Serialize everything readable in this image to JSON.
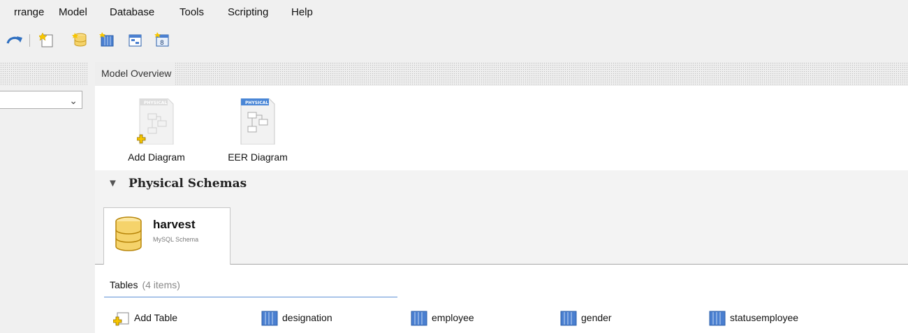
{
  "menubar": {
    "items": [
      "rrange",
      "Model",
      "Database",
      "Tools",
      "Scripting",
      "Help"
    ]
  },
  "toolbar": {
    "buttons": [
      {
        "icon": "redo-icon"
      },
      {
        "icon": "new-document-icon"
      },
      {
        "icon": "add-schema-icon"
      },
      {
        "icon": "add-table-icon"
      },
      {
        "icon": "add-view-icon"
      },
      {
        "icon": "add-routine-icon"
      }
    ]
  },
  "left_panel": {
    "dropdown_value": ""
  },
  "overview": {
    "title": "Model Overview",
    "diagrams": [
      {
        "label": "Add Diagram",
        "badge": "PHYSICAL",
        "icon": "add-diagram-icon"
      },
      {
        "label": "EER Diagram",
        "badge": "PHYSICAL",
        "icon": "eer-diagram-icon"
      }
    ],
    "schemas_section": {
      "title": "Physical Schemas",
      "schema_tab": {
        "name": "harvest",
        "subtitle": "MySQL Schema"
      },
      "tables": {
        "label": "Tables",
        "count": "(4 items)",
        "items": [
          {
            "label": "Add Table",
            "icon": "add-table-icon"
          },
          {
            "label": "designation",
            "icon": "table-icon"
          },
          {
            "label": "employee",
            "icon": "table-icon"
          },
          {
            "label": "gender",
            "icon": "table-icon"
          },
          {
            "label": "statusemployee",
            "icon": "table-icon"
          }
        ]
      }
    }
  },
  "colors": {
    "panel_bg": "#f0f0f0",
    "accent_blue": "#5b8fd6",
    "table_icon_blue": "#4a7fd0",
    "db_icon_yellow": "#f5d36b"
  }
}
